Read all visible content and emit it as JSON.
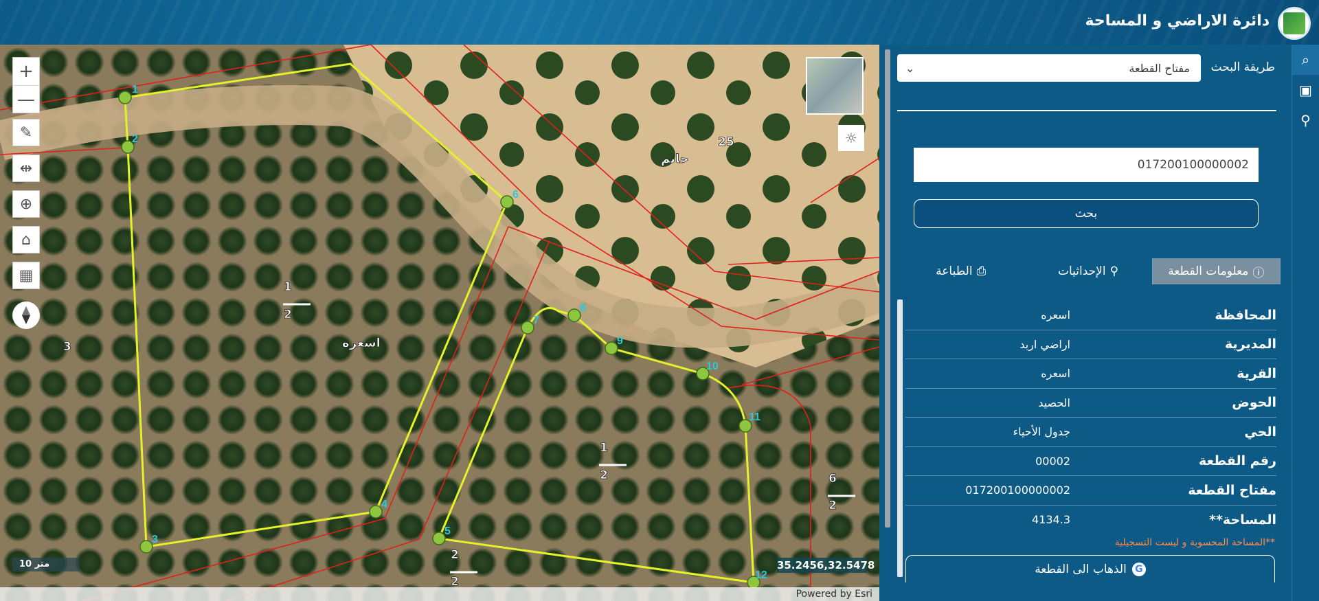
{
  "header": {
    "title": "دائرة الاراضي و المساحة"
  },
  "map": {
    "zoom_in_label": "+",
    "zoom_out_label": "—",
    "scale_label": "10 متر",
    "coords": "35.2456,32.5478",
    "powered_by": "Powered by Esri",
    "labels": {
      "village_1": "اسعره",
      "village_2": "حاتم",
      "parcel_25": "25",
      "parcel_3": "3",
      "parcel_6": "6",
      "frac_1a_num": "1",
      "frac_1a_den": "2",
      "frac_1b_num": "1",
      "frac_1b_den": "2",
      "frac_6_den": "2",
      "frac_2_num": "2",
      "frac_2_den": "2"
    },
    "vertices": [
      "1",
      "2",
      "3",
      "4",
      "5",
      "6",
      "7",
      "8",
      "9",
      "10",
      "11",
      "12"
    ]
  },
  "search": {
    "method_label": "طريقة البحث",
    "method_value": "مفتاح القطعة",
    "input_value": "017200100000002",
    "button_label": "بحث"
  },
  "tabs": [
    {
      "label": "معلومات القطعة"
    },
    {
      "label": "الإحداثيات"
    },
    {
      "label": "الطباعة"
    }
  ],
  "parcel_info": [
    {
      "key": "المحافظة",
      "value": "اسعره"
    },
    {
      "key": "المديرية",
      "value": "اراضي اربد"
    },
    {
      "key": "القرية",
      "value": "اسعره"
    },
    {
      "key": "الحوض",
      "value": "الحصيد"
    },
    {
      "key": "الحي",
      "value": "جدول الأحياء"
    },
    {
      "key": "رقم القطعة",
      "value": "00002"
    },
    {
      "key": "مفتاح القطعة",
      "value": "017200100000002"
    },
    {
      "key": "المساحة**",
      "value": "4134.3"
    }
  ],
  "note": "**المساحة المحسوبة و ليست التسجيلية",
  "goto_label": "الذهاب الى القطعة",
  "colors": {
    "parcel_line": "#e3f22a",
    "boundary": "#e0201a",
    "vertex": "#8ec63f",
    "panel": "#0d5a86"
  }
}
